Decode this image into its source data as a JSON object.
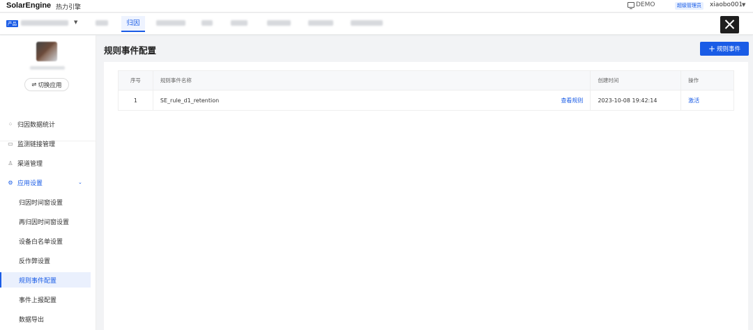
{
  "topbar": {
    "brand": "SolarEngine",
    "brand_cn": "热力引擎",
    "demo_label": "DEMO",
    "role_badge": "超级管理员",
    "username": "xiaobo001"
  },
  "navbar": {
    "product_badge": "产品",
    "active_tab": "归因"
  },
  "sidebar": {
    "switch_app_label": "切换应用",
    "menu": [
      {
        "label": "归因数据统计",
        "icon": "attribution-icon"
      },
      {
        "label": "监测链接管理",
        "icon": "monitor-link-icon"
      },
      {
        "label": "渠道管理",
        "icon": "channel-icon"
      }
    ],
    "group": {
      "label": "应用设置",
      "icon": "settings-icon",
      "items": [
        {
          "label": "归因时间窗设置"
        },
        {
          "label": "再归因时间窗设置"
        },
        {
          "label": "设备白名单设置"
        },
        {
          "label": "反作弊设置"
        },
        {
          "label": "规则事件配置"
        },
        {
          "label": "事件上报配置"
        },
        {
          "label": "数据导出"
        }
      ]
    }
  },
  "main": {
    "title": "规则事件配置",
    "add_button": "规则事件",
    "table": {
      "headers": [
        "序号",
        "规则事件名称",
        "创建时间",
        "操作"
      ],
      "rows": [
        {
          "index": "1",
          "name": "SE_rule_d1_retention",
          "view_link": "查看规则",
          "created": "2023-10-08 19:42:14",
          "action": "激活"
        }
      ]
    }
  },
  "colors": {
    "accent": "#1a5ce6",
    "active_bg": "#eaf0fd"
  }
}
